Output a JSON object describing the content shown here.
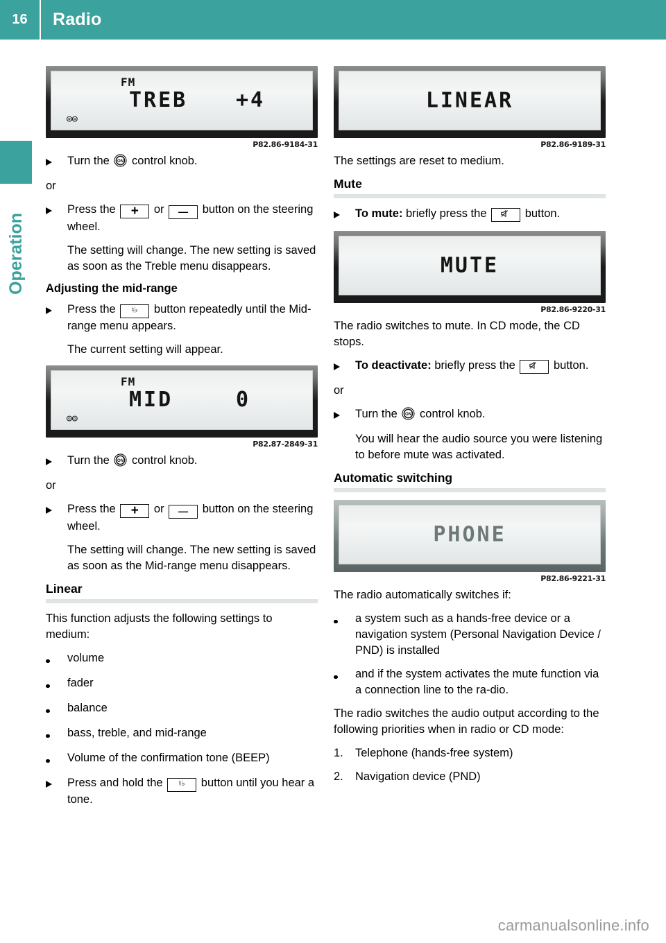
{
  "header": {
    "page_number": "16",
    "title": "Radio"
  },
  "sidebar": {
    "chapter_label": "Operation"
  },
  "watermark": "carmanualsonline.info",
  "left_column": {
    "display_treble": {
      "band": "FM",
      "label": "TREB",
      "value": "+4",
      "stereo_icon": "stereo-icon",
      "caption": "P82.86-9184-31"
    },
    "step_turn_knob": {
      "text_before": "Turn the",
      "icon": "control-knob-icon",
      "text_after": "control knob."
    },
    "or_1": "or",
    "step_press_plus_minus": {
      "text_before": "Press the",
      "key_plus": "+",
      "text_middle": "or",
      "key_minus": "—",
      "text_after": "button on the steering wheel."
    },
    "result_treble": "The setting will change. The new setting is saved as soon as the Treble menu disappears.",
    "subhead_midrange": "Adjusting the mid-range",
    "step_press_sound": {
      "text_before": "Press the",
      "icon": "sound-menu-icon",
      "text_after": "button repeatedly until the Mid-range menu appears."
    },
    "result_current_setting": "The current setting will appear.",
    "display_mid": {
      "band": "FM",
      "label": "MID",
      "value": "0",
      "stereo_icon": "stereo-icon",
      "caption": "P82.87-2849-31"
    },
    "step_turn_knob_2": {
      "text_before": "Turn the",
      "icon": "control-knob-icon",
      "text_after": "control knob."
    },
    "or_2": "or",
    "step_press_plus_minus_2": {
      "text_before": "Press the",
      "key_plus": "+",
      "text_middle": "or",
      "key_minus": "—",
      "text_after": "button on the steering wheel."
    },
    "result_midrange": "The setting will change. The new setting is saved as soon as the Mid-range menu disappears.",
    "section_linear": "Linear",
    "linear_intro": "This function adjusts the following settings to medium:",
    "linear_bullets": [
      "volume",
      "fader",
      "balance",
      "bass, treble, and mid-range",
      "Volume of the confirmation tone (BEEP)"
    ],
    "step_press_hold": {
      "text_before": "Press and hold the",
      "icon": "sound-menu-icon",
      "text_after": "button until you hear a tone."
    }
  },
  "right_column": {
    "display_linear": {
      "label": "LINEAR",
      "caption": "P82.86-9189-31"
    },
    "reset_text": "The settings are reset to medium.",
    "section_mute": "Mute",
    "step_to_mute": {
      "bold_lead": "To mute:",
      "text_before": "briefly press the",
      "icon": "mute-icon",
      "text_after": "button."
    },
    "display_mute": {
      "label": "MUTE",
      "caption": "P82.86-9220-31"
    },
    "mute_result": "The radio switches to mute. In CD mode, the CD stops.",
    "step_deactivate": {
      "bold_lead": "To deactivate:",
      "text_before": "briefly press the",
      "icon": "mute-icon",
      "text_after": "button."
    },
    "or_3": "or",
    "step_turn_knob_3": {
      "text_before": "Turn the",
      "icon": "control-knob-icon",
      "text_after": "control knob."
    },
    "result_audio_source": "You will hear the audio source you were listening to before mute was activated.",
    "section_auto": "Automatic switching",
    "display_phone": {
      "label": "PHONE",
      "caption": "P82.86-9221-31"
    },
    "auto_intro": "The radio automatically switches if:",
    "auto_bullets": [
      "a system such as a hands-free device or a navigation system (Personal Navigation Device / PND) is installed",
      "and if the system activates the mute function via a connection line to the ra-dio."
    ],
    "priority_intro": "The radio switches the audio output according to the following priorities when in radio or CD mode:",
    "priority_items": [
      {
        "number": "1.",
        "label": "Telephone (hands-free system)"
      },
      {
        "number": "2.",
        "label": "Navigation device (PND)"
      }
    ]
  },
  "colors": {
    "accent": "#3ba29e",
    "rule": "#dfe3e3",
    "watermark": "#9a9a9a"
  }
}
